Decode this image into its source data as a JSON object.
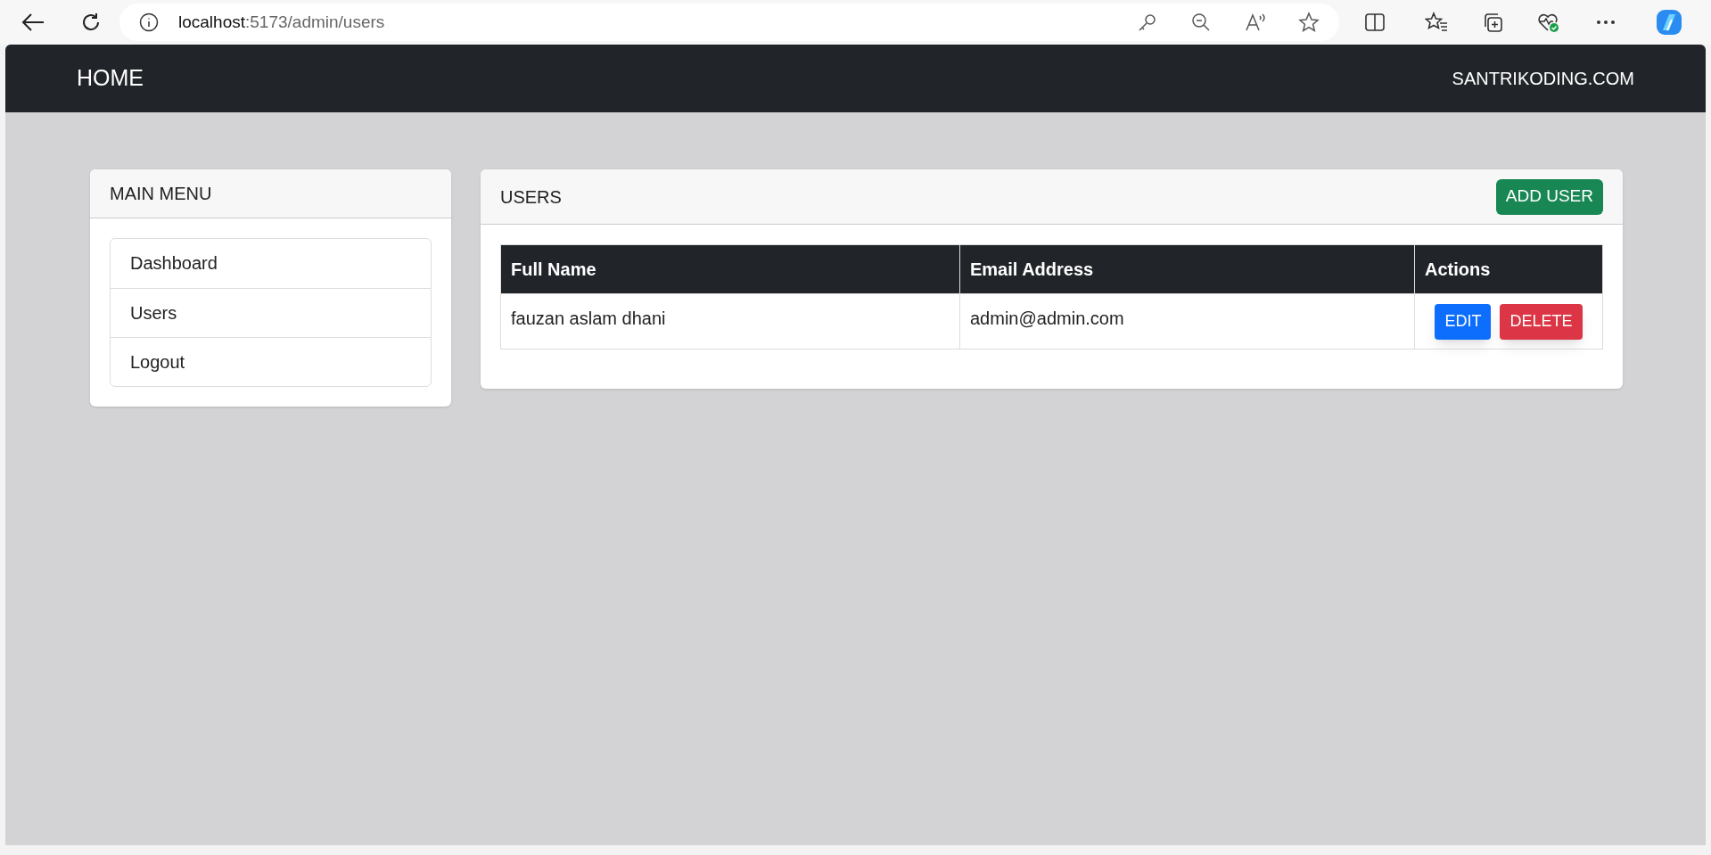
{
  "browser": {
    "url_host": "localhost",
    "url_path": ":5173/admin/users"
  },
  "navbar": {
    "brand": "HOME",
    "right_link": "SANTRIKODING.COM"
  },
  "sidebar": {
    "title": "MAIN MENU",
    "items": [
      {
        "label": "Dashboard"
      },
      {
        "label": "Users"
      },
      {
        "label": "Logout"
      }
    ]
  },
  "users_card": {
    "title": "USERS",
    "add_button": "ADD USER",
    "table": {
      "columns": [
        "Full Name",
        "Email Address",
        "Actions"
      ],
      "rows": [
        {
          "full_name": "fauzan aslam dhani",
          "email": "admin@admin.com",
          "edit": "EDIT",
          "delete": "DELETE"
        }
      ]
    }
  }
}
